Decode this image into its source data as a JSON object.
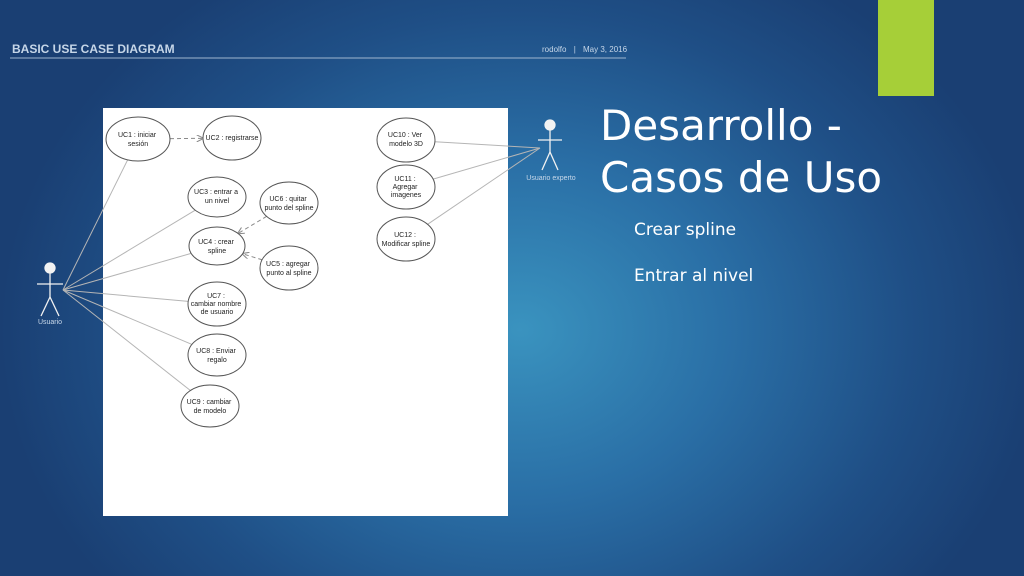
{
  "slide": {
    "title_lines": [
      "Desarrollo -",
      "Casos de Uso"
    ],
    "bullets": [
      "Crear spline",
      "Entrar al nivel"
    ],
    "accent_color": "#a6cf38"
  },
  "diagram": {
    "header_title": "BASIC USE CASE DIAGRAM",
    "author": "rodolfo",
    "separator": "|",
    "date": "May 3, 2016",
    "actors": [
      {
        "id": "usuario",
        "label": "Usuario"
      },
      {
        "id": "experto",
        "label": "Usuario experto"
      }
    ],
    "use_cases": [
      {
        "id": "uc1",
        "lines": [
          "UC1 : iniciar",
          "sesión"
        ]
      },
      {
        "id": "uc2",
        "lines": [
          "UC2 : registrarse"
        ]
      },
      {
        "id": "uc3",
        "lines": [
          "UC3 : entrar a",
          "un nivel"
        ]
      },
      {
        "id": "uc6",
        "lines": [
          "UC6 : quitar",
          "punto del spline"
        ]
      },
      {
        "id": "uc4",
        "lines": [
          "UC4 : crear",
          "spline"
        ]
      },
      {
        "id": "uc5",
        "lines": [
          "UC5 : agregar",
          "punto al spline"
        ]
      },
      {
        "id": "uc7",
        "lines": [
          "UC7 :",
          "cambiar nombre",
          "de usuario"
        ]
      },
      {
        "id": "uc8",
        "lines": [
          "UC8 : Enviar",
          "regalo"
        ]
      },
      {
        "id": "uc9",
        "lines": [
          "UC9 : cambiar",
          "de modelo"
        ]
      },
      {
        "id": "uc10",
        "lines": [
          "UC10 : Ver",
          "modelo 3D"
        ]
      },
      {
        "id": "uc11",
        "lines": [
          "UC11 :",
          "Agregar",
          "imagenes"
        ]
      },
      {
        "id": "uc12",
        "lines": [
          "UC12 :",
          "Modificar spline"
        ]
      }
    ],
    "associations": [
      [
        "usuario",
        "uc1"
      ],
      [
        "usuario",
        "uc3"
      ],
      [
        "usuario",
        "uc4"
      ],
      [
        "usuario",
        "uc7"
      ],
      [
        "usuario",
        "uc8"
      ],
      [
        "usuario",
        "uc9"
      ],
      [
        "experto",
        "uc10"
      ],
      [
        "experto",
        "uc11"
      ],
      [
        "experto",
        "uc12"
      ]
    ],
    "dependencies": [
      [
        "uc1",
        "uc2"
      ],
      [
        "uc6",
        "uc4"
      ],
      [
        "uc5",
        "uc4"
      ]
    ]
  }
}
